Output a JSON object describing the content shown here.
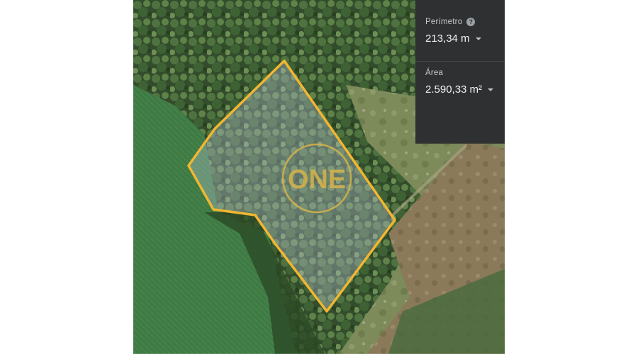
{
  "watermark": {
    "text": "ONE"
  },
  "measure_panel": {
    "perimeter": {
      "label": "Perímetro",
      "value": "213,34 m"
    },
    "area": {
      "label": "Área",
      "value": "2.590,33 m²"
    }
  },
  "colors": {
    "boundary": "#f2b630",
    "polygon_fill": "rgba(175,190,205,0.38)",
    "panel_bg": "#2f3032"
  },
  "icons": {
    "help": "help-icon",
    "dropdown": "chevron-down-icon"
  }
}
